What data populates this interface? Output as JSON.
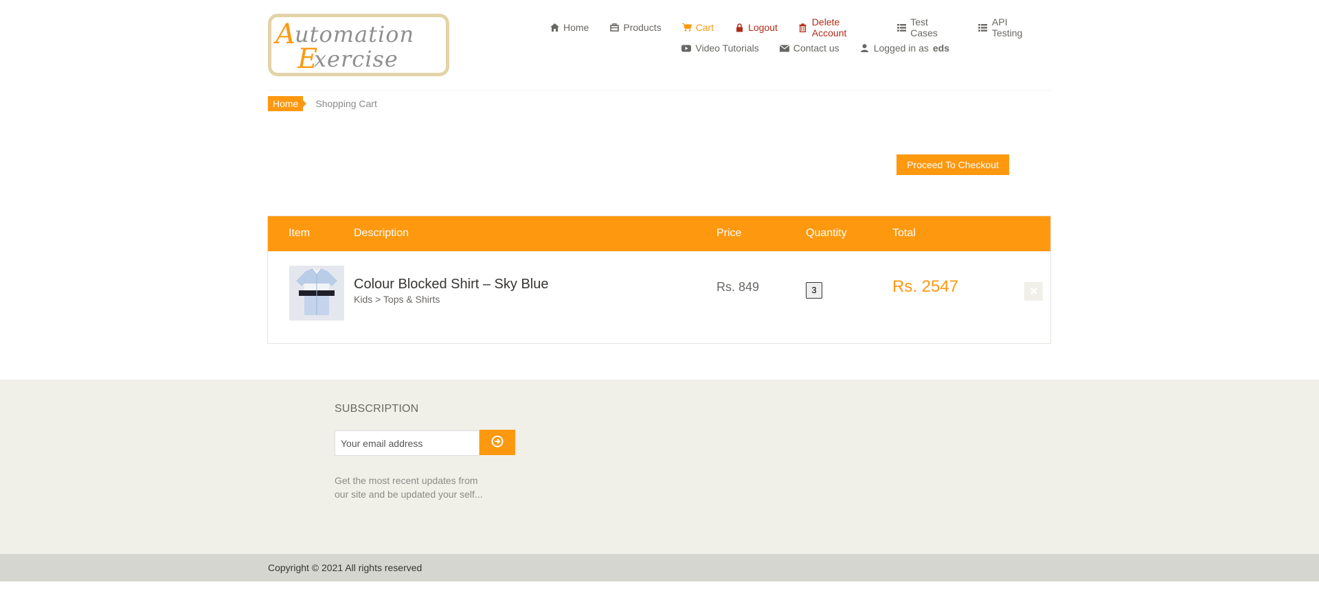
{
  "brand": {
    "line1": "Automation",
    "line2": "Exercise",
    "accent_color": "#fe980f"
  },
  "nav": {
    "row1": [
      {
        "label": "Home",
        "icon": "home-icon"
      },
      {
        "label": "Products",
        "icon": "products-icon"
      },
      {
        "label": "Cart",
        "icon": "cart-icon",
        "state": "active"
      },
      {
        "label": "Logout",
        "icon": "lock-icon"
      },
      {
        "label": "Delete Account",
        "icon": "trash-icon"
      },
      {
        "label": "Test Cases",
        "icon": "list-icon"
      },
      {
        "label": "API Testing",
        "icon": "list-icon"
      }
    ],
    "row2": [
      {
        "label": "Video Tutorials",
        "icon": "youtube-icon"
      },
      {
        "label": "Contact us",
        "icon": "envelope-icon"
      },
      {
        "label_prefix": "Logged in as",
        "username": "eds",
        "icon": "user-icon"
      }
    ]
  },
  "breadcrumb": {
    "home": "Home",
    "current": "Shopping Cart"
  },
  "checkout_button": "Proceed To Checkout",
  "cart": {
    "headers": {
      "item": "Item",
      "description": "Description",
      "price": "Price",
      "quantity": "Quantity",
      "total": "Total"
    },
    "rows": [
      {
        "name": "Colour Blocked Shirt – Sky Blue",
        "category": "Kids > Tops & Shirts",
        "price": "Rs. 849",
        "quantity": "3",
        "total": "Rs. 2547",
        "delete_icon": "close-icon"
      }
    ]
  },
  "subscription": {
    "title": "SUBSCRIPTION",
    "placeholder": "Your email address",
    "submit_icon": "arrow-circle-right-icon",
    "text": "Get the most recent updates from our site and be updated your self..."
  },
  "footer": {
    "copyright": "Copyright © 2021 All rights reserved"
  },
  "colors": {
    "accent": "#fe980f",
    "danger": "#b02a17",
    "footer_bg": "#f0f0e9",
    "footer_bottom_bg": "#d6d6d0"
  }
}
